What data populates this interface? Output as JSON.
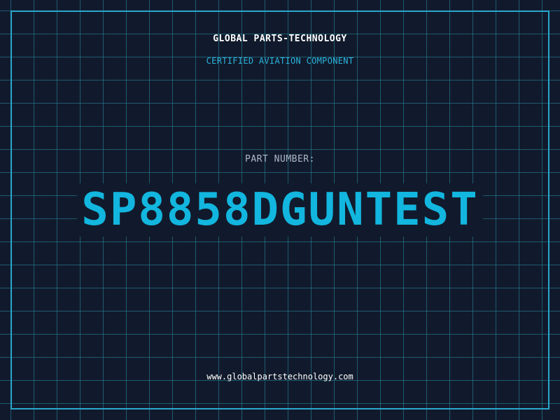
{
  "header": {
    "brand": "GLOBAL PARTS-TECHNOLOGY",
    "tagline": "CERTIFIED AVIATION COMPONENT"
  },
  "part": {
    "label": "PART NUMBER:",
    "number": "SP8858DGUNTEST"
  },
  "footer": {
    "website": "www.globalpartstechnology.com"
  },
  "colors": {
    "background": "#111a2c",
    "grid": "#288ca5",
    "frame": "#29a7cc",
    "accent": "#12b6de",
    "tagline": "#2bb3dc",
    "label": "#aeb8c8",
    "text": "#ffffff"
  }
}
